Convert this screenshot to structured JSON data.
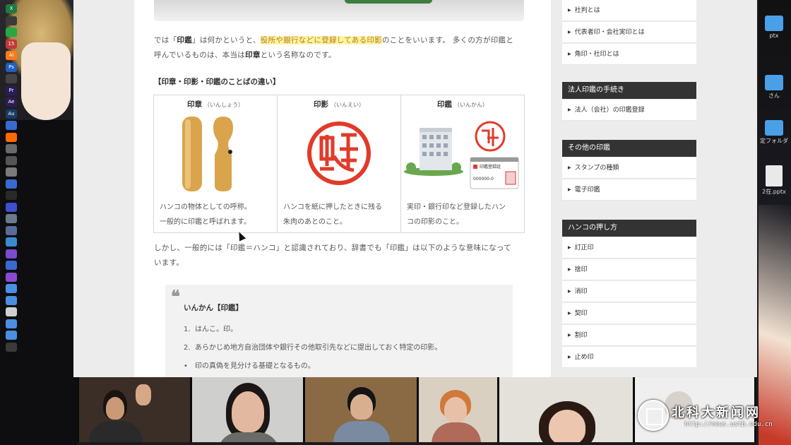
{
  "article": {
    "intro_pre": "では「",
    "intro_b1": "印鑑",
    "intro_mid": "」は何かというと、",
    "intro_hl": "役所や銀行などに登録してある印影",
    "intro_post": "のことをいいます。 多くの方が印鑑と",
    "intro_line2_pre": "呼んでいるものは、本当は",
    "intro_line2_b": "印章",
    "intro_line2_post": "という名称なのです。",
    "section_title": "【印章・印影・印鑑のことばの違い】",
    "table": [
      {
        "title": "印章",
        "reading": "（いんしょう）",
        "desc1": "ハンコの物体としての呼称。",
        "desc2": "一般的に印鑑と呼ばれます。"
      },
      {
        "title": "印影",
        "reading": "（いんえい）",
        "desc1": "ハンコを紙に押したときに残る",
        "desc2": "朱肉のあとのこと。"
      },
      {
        "title": "印鑑",
        "reading": "（いんかん）",
        "desc1": "実印・銀行印など登録したハン",
        "desc2": "コの印影のこと。"
      }
    ],
    "card_label": "印鑑登録証",
    "card_number": "000000-0",
    "after1": "しかし、一般的には「印鑑＝ハンコ」と認識されており、辞書でも「印鑑」は以下のような意味になって",
    "after2": "います。",
    "quote": {
      "mark": "❝",
      "title": "いんかん【印鑑】",
      "items": [
        {
          "num": "1.",
          "text": "はんこ。印。"
        },
        {
          "num": "2.",
          "text": "あらかじめ地方自治団体や銀行その他取引先などに提出しておく特定の印影。"
        }
      ],
      "sub": "印の真偽を見分ける基礎となるもの。"
    }
  },
  "sidebar": {
    "top_links": [
      "社判とは",
      "代表者印・会社実印とは",
      "角印・社印とは"
    ],
    "sections": [
      {
        "title": "法人印鑑の手続き",
        "links": [
          "法人（会社）の印鑑登録"
        ]
      },
      {
        "title": "その他の印鑑",
        "links": [
          "スタンプの種類",
          "電子印鑑"
        ]
      },
      {
        "title": "ハンコの押し方",
        "links": [
          "訂正印",
          "捨印",
          "消印",
          "契印",
          "割印",
          "止め印"
        ]
      }
    ]
  },
  "desktop": {
    "items": [
      {
        "label": "ptx"
      },
      {
        "label": "さん"
      },
      {
        "label": "定フォルダ"
      },
      {
        "label": "2在.pptx"
      }
    ]
  },
  "dock": {
    "icons": [
      "X",
      "",
      "",
      "15",
      "Ai",
      "Ps",
      "",
      "Pr",
      "Ae",
      "Au",
      "",
      "",
      "",
      "",
      "",
      "",
      "",
      "",
      "",
      "",
      "",
      "",
      "",
      "",
      "",
      "",
      "",
      "",
      "",
      ""
    ]
  },
  "watermark": {
    "text": "北科大新闻网",
    "url": "http://news.ustb.edu.cn"
  },
  "colors": {
    "highlight": "#fff4a0",
    "sidebar_header": "#333333",
    "seal_red": "#e23a2a"
  }
}
